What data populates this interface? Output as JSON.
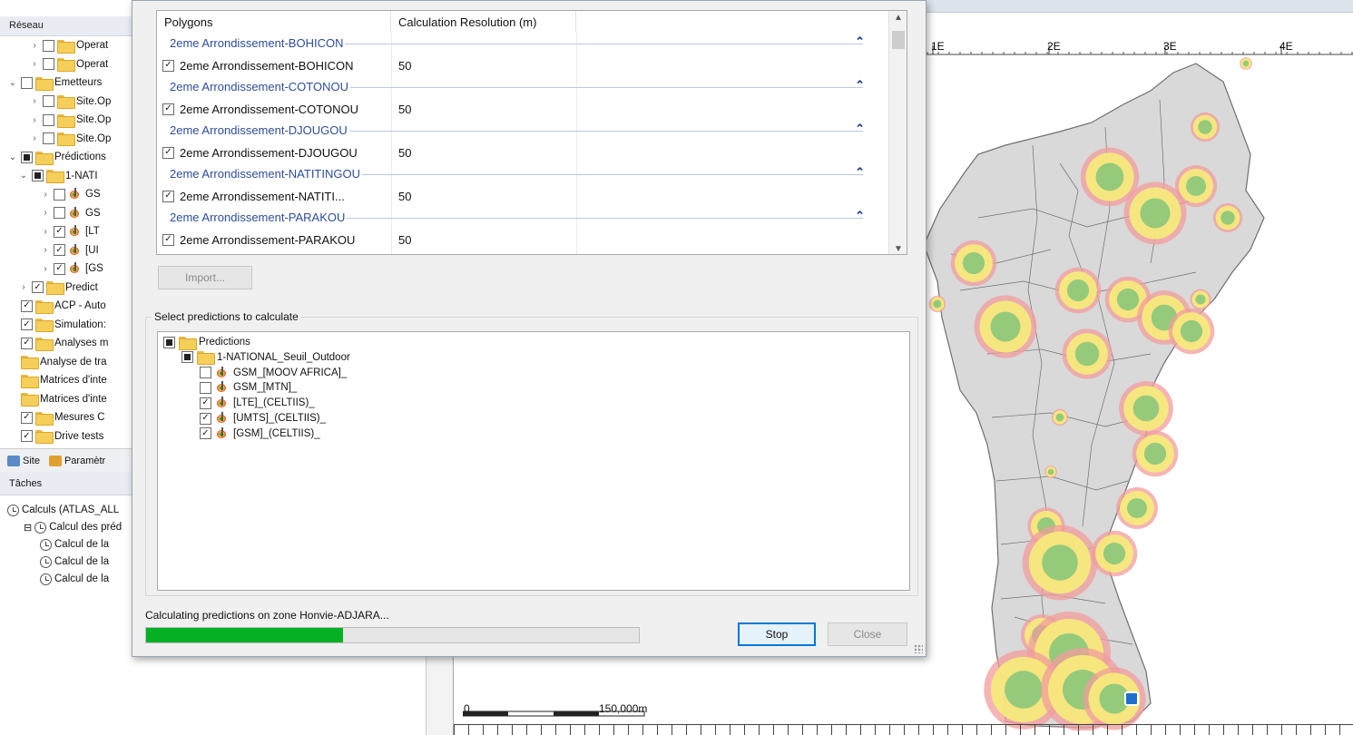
{
  "explorer": {
    "title": "Réseau",
    "items": [
      {
        "label": "Operat",
        "depth": 2,
        "chev": "›",
        "check": "",
        "icon": "folder"
      },
      {
        "label": "Operat",
        "depth": 2,
        "chev": "›",
        "check": "",
        "icon": "folder"
      },
      {
        "label": "Emetteurs",
        "depth": 0,
        "chev": "⌄",
        "check": "",
        "icon": "folder"
      },
      {
        "label": "Site.Op",
        "depth": 2,
        "chev": "›",
        "check": "",
        "icon": "folder"
      },
      {
        "label": "Site.Op",
        "depth": 2,
        "chev": "›",
        "check": "",
        "icon": "folder"
      },
      {
        "label": "Site.Op",
        "depth": 2,
        "chev": "›",
        "check": "",
        "icon": "folder"
      },
      {
        "label": "Prédictions",
        "depth": 0,
        "chev": "⌄",
        "check": "partial",
        "icon": "folder"
      },
      {
        "label": "1-NATI",
        "depth": 1,
        "chev": "⌄",
        "check": "partial",
        "icon": "folder"
      },
      {
        "label": "GS",
        "depth": 3,
        "chev": "›",
        "check": "",
        "icon": "prediction"
      },
      {
        "label": "GS",
        "depth": 3,
        "chev": "›",
        "check": "",
        "icon": "prediction"
      },
      {
        "label": "[LT",
        "depth": 3,
        "chev": "›",
        "check": "✓",
        "icon": "prediction"
      },
      {
        "label": "[UI",
        "depth": 3,
        "chev": "›",
        "check": "✓",
        "icon": "prediction"
      },
      {
        "label": "[GS",
        "depth": 3,
        "chev": "›",
        "check": "✓",
        "icon": "prediction"
      },
      {
        "label": "Predict",
        "depth": 1,
        "chev": "›",
        "check": "✓",
        "icon": "folder"
      },
      {
        "label": "ACP - Auto",
        "depth": 0,
        "chev": "",
        "check": "✓",
        "icon": "folder"
      },
      {
        "label": "Simulation:",
        "depth": 0,
        "chev": "",
        "check": "✓",
        "icon": "folder"
      },
      {
        "label": "Analyses m",
        "depth": 0,
        "chev": "",
        "check": "✓",
        "icon": "folder"
      },
      {
        "label": "Analyse de tra",
        "depth": 0,
        "chev": "",
        "check": "none",
        "icon": "folder"
      },
      {
        "label": "Matrices d'inte",
        "depth": 0,
        "chev": "",
        "check": "none",
        "icon": "folder"
      },
      {
        "label": "Matrices d'inte",
        "depth": 0,
        "chev": "",
        "check": "none",
        "icon": "folder"
      },
      {
        "label": "Mesures C",
        "depth": 0,
        "chev": "",
        "check": "✓",
        "icon": "folder"
      },
      {
        "label": "Drive tests",
        "depth": 0,
        "chev": "",
        "check": "✓",
        "icon": "folder"
      }
    ],
    "tabs": [
      {
        "label": "Site",
        "icon": "site-tab-icon"
      },
      {
        "label": "Paramètr",
        "icon": "parameters-tab-icon"
      }
    ]
  },
  "tasks": {
    "title": "Tâches",
    "items": [
      {
        "label": "Calculs (ATLAS_ALL",
        "depth": 0
      },
      {
        "label": "Calcul des préd",
        "depth": 1
      },
      {
        "label": "Calcul de la",
        "depth": 2
      },
      {
        "label": "Calcul de la",
        "depth": 2
      },
      {
        "label": "Calcul de la",
        "depth": 2
      }
    ]
  },
  "map": {
    "longitude_labels": [
      "1E",
      "2E",
      "3E",
      "4E"
    ],
    "scalebar": {
      "start": "0",
      "end": "150,000m"
    },
    "colors": {
      "land": "#d9d9d9",
      "border": "#6f6f6f",
      "coverage_low": "#f29c9c",
      "coverage_mid": "#f7ec7a",
      "coverage_high": "#8fc87b"
    }
  },
  "dialog": {
    "polygons_table": {
      "columns": [
        "Polygons",
        "Calculation Resolution (m)"
      ],
      "groups": [
        {
          "group": "2eme Arrondissement-BOHICON",
          "name": "2eme Arrondissement-BOHICON",
          "resolution": "50"
        },
        {
          "group": "2eme Arrondissement-COTONOU",
          "name": "2eme Arrondissement-COTONOU",
          "resolution": "50"
        },
        {
          "group": "2eme Arrondissement-DJOUGOU",
          "name": "2eme Arrondissement-DJOUGOU",
          "resolution": "50"
        },
        {
          "group": "2eme Arrondissement-NATITINGOU",
          "name": "2eme Arrondissement-NATITI...",
          "resolution": "50"
        },
        {
          "group": "2eme Arrondissement-PARAKOU",
          "name": "2eme Arrondissement-PARAKOU",
          "resolution": "50"
        }
      ]
    },
    "import_label": "Import...",
    "predictions_group_label": "Select predictions to calculate",
    "prediction_tree": [
      {
        "label": "Predictions",
        "depth": 0,
        "check": "partial",
        "icon": "folder"
      },
      {
        "label": "1-NATIONAL_Seuil_Outdoor",
        "depth": 1,
        "check": "partial",
        "icon": "folder"
      },
      {
        "label": "GSM_[MOOV AFRICA]_",
        "depth": 2,
        "check": "",
        "icon": "prediction"
      },
      {
        "label": "GSM_[MTN]_",
        "depth": 2,
        "check": "",
        "icon": "prediction"
      },
      {
        "label": "[LTE]_(CELTIIS)_",
        "depth": 2,
        "check": "✓",
        "icon": "prediction"
      },
      {
        "label": "[UMTS]_(CELTIIS)_",
        "depth": 2,
        "check": "✓",
        "icon": "prediction"
      },
      {
        "label": "[GSM]_(CELTIIS)_",
        "depth": 2,
        "check": "✓",
        "icon": "prediction"
      }
    ],
    "status_text": "Calculating predictions on zone Honvie-ADJARA...",
    "progress": 0.4,
    "progress_color": "#06b025",
    "stop_label": "Stop",
    "close_label": "Close"
  }
}
